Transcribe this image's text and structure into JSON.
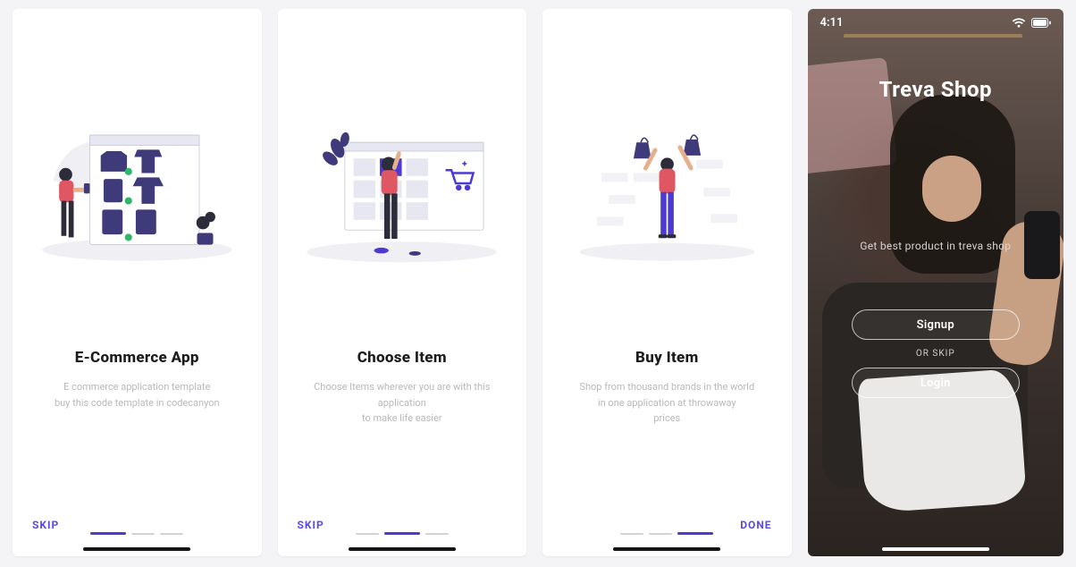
{
  "accent": "#5a48e8",
  "screens": [
    {
      "title": "E-Commerce App",
      "desc": "E commerce application template\nbuy this code template in codecanyon",
      "skip": "SKIP",
      "done": "",
      "doneShown": false,
      "active": 0
    },
    {
      "title": "Choose Item",
      "desc": "Choose Items wherever you are with this application\nto make life easier",
      "skip": "SKIP",
      "done": "",
      "doneShown": false,
      "active": 1
    },
    {
      "title": "Buy Item",
      "desc": "Shop from thousand brands in the world\nin one application at throwaway\nprices",
      "skip": "",
      "done": "DONE",
      "doneShown": true,
      "active": 2
    }
  ],
  "auth": {
    "time": "4:11",
    "brand": "Treva Shop",
    "tagline": "Get best product in treva shop",
    "signup": "Signup",
    "orskip": "OR SKIP",
    "login": "Login"
  }
}
